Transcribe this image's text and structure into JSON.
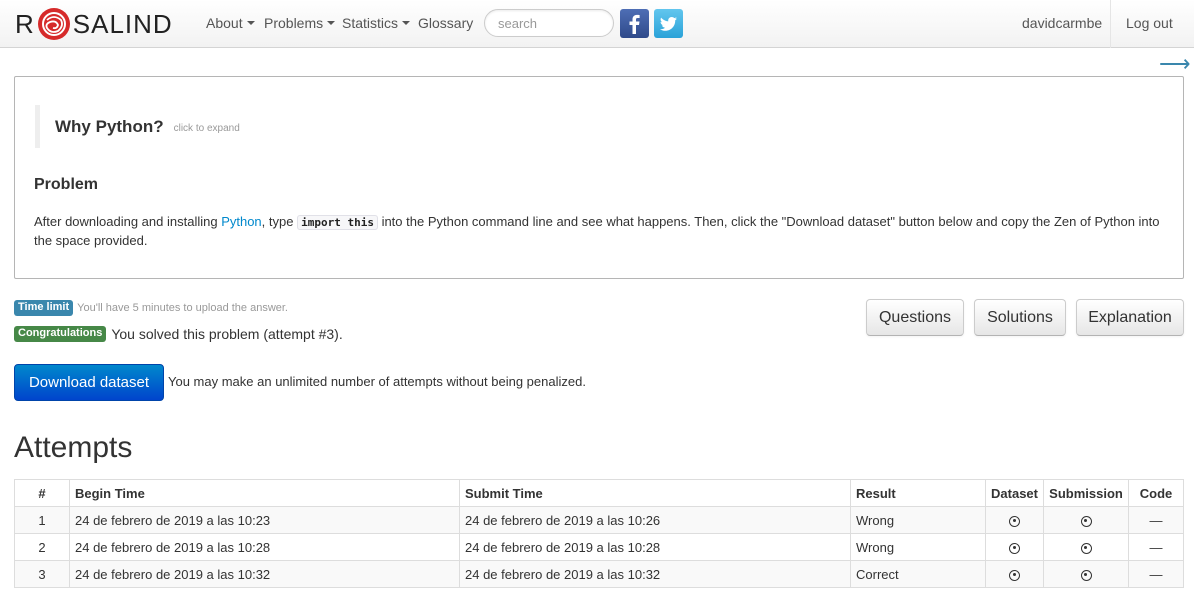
{
  "navbar": {
    "brand_left": "R",
    "brand_right": "SALIND",
    "menu": [
      {
        "label": "About",
        "dropdown": true
      },
      {
        "label": "Problems",
        "dropdown": true
      },
      {
        "label": "Statistics",
        "dropdown": true
      },
      {
        "label": "Glossary",
        "dropdown": false
      }
    ],
    "search_placeholder": "search",
    "social": [
      "facebook-icon",
      "twitter-icon"
    ],
    "username": "davidcarmbe",
    "logout": "Log out"
  },
  "next_arrow": "⟶",
  "problem": {
    "why_title": "Why Python?",
    "why_hint": "click to expand",
    "heading": "Problem",
    "text_before_link": "After downloading and installing ",
    "link": "Python",
    "text_after_link": ", type ",
    "code": "import this",
    "text_after_code": " into the Python command line and see what happens. Then, click the \"Download dataset\" button below and copy the Zen of Python into the space provided."
  },
  "status": {
    "time_limit_label": "Time limit",
    "time_limit_text": "You'll have 5 minutes to upload the answer.",
    "congrats_label": "Congratulations",
    "congrats_text": "You solved this problem (attempt #3)."
  },
  "buttons": {
    "questions": "Questions",
    "solutions": "Solutions",
    "explanation": "Explanation"
  },
  "download": {
    "button": "Download dataset",
    "note": "You may make an unlimited number of attempts without being penalized."
  },
  "attempts": {
    "title": "Attempts",
    "columns": [
      "#",
      "Begin Time",
      "Submit Time",
      "Result",
      "Dataset",
      "Submission",
      "Code"
    ],
    "rows": [
      {
        "num": "1",
        "begin": "24 de febrero de 2019 a las 10:23",
        "submit": "24 de febrero de 2019 a las 10:26",
        "result": "Wrong",
        "code": "—"
      },
      {
        "num": "2",
        "begin": "24 de febrero de 2019 a las 10:28",
        "submit": "24 de febrero de 2019 a las 10:28",
        "result": "Wrong",
        "code": "—"
      },
      {
        "num": "3",
        "begin": "24 de febrero de 2019 a las 10:32",
        "submit": "24 de febrero de 2019 a las 10:32",
        "result": "Correct",
        "code": "—"
      }
    ]
  },
  "colors": {
    "accent": "#0088cc",
    "label_info": "#3a87ad",
    "label_success": "#468847",
    "logo_red": "#d62a2a"
  }
}
